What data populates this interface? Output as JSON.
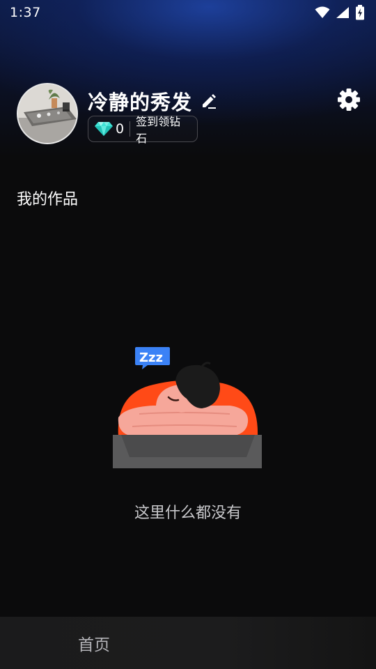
{
  "status_bar": {
    "time": "1:37",
    "icons": [
      "wifi-icon",
      "cellular-signal-icon",
      "battery-charging-icon"
    ]
  },
  "profile": {
    "username": "冷静的秀发",
    "diamond_count": "0",
    "checkin_label": "签到领钻石",
    "icons": [
      "edit-icon",
      "diamond-icon",
      "settings-icon"
    ]
  },
  "works_section": {
    "title": "我的作品"
  },
  "empty_state": {
    "message": "这里什么都没有",
    "bubble_text": "Zzz"
  },
  "tab_bar": {
    "tabs": [
      {
        "label": "首页"
      }
    ]
  },
  "colors": {
    "background": "#0b0b0c",
    "header_glow": "#2046aa",
    "diamond": "#3fe3d6",
    "pillow": "#ff4a17",
    "skin": "#f6a79a",
    "tab_bar": "#1b1b1c",
    "bubble": "#3b82f6"
  }
}
